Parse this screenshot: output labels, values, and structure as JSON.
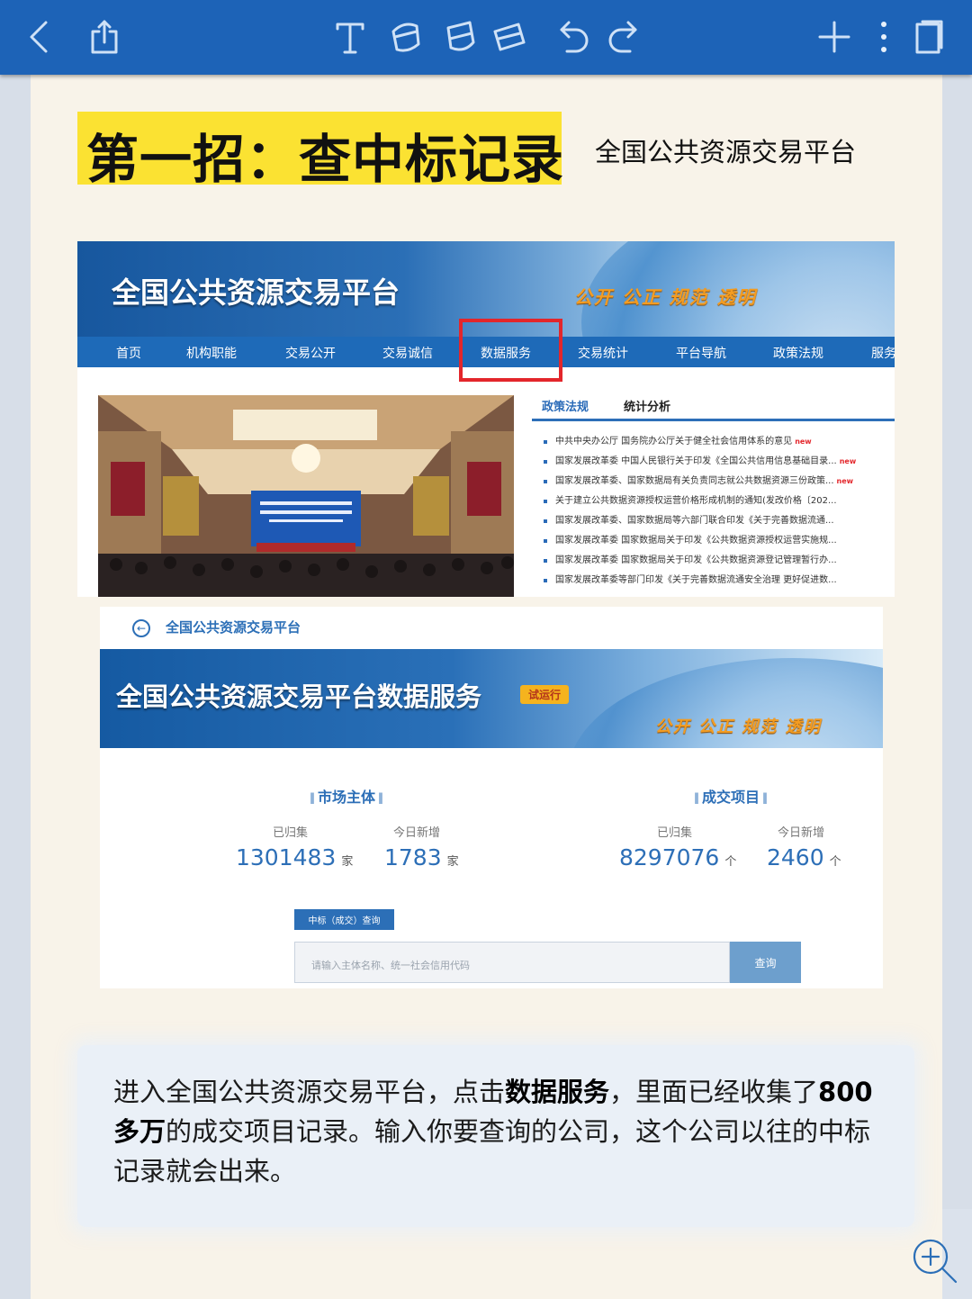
{
  "toolbar": {
    "icons": [
      "back-icon",
      "share-icon",
      "text-tool-icon",
      "pen-tool-icon",
      "highlighter-tool-icon",
      "eraser-tool-icon",
      "undo-icon",
      "redo-icon",
      "add-icon",
      "more-icon",
      "page-view-icon"
    ]
  },
  "page": {
    "title": "第一招：查中标记录",
    "subtitle": "全国公共资源交易平台"
  },
  "shot1": {
    "banner_title": "全国公共资源交易平台",
    "slogan": "公开 公正 规范 透明",
    "nav": [
      "首页",
      "机构职能",
      "交易公开",
      "交易诚信",
      "数据服务",
      "交易统计",
      "平台导航",
      "政策法规",
      "服务"
    ],
    "highlighted_nav": "数据服务",
    "tabs": [
      "政策法规",
      "统计分析"
    ],
    "news": [
      {
        "text": "中共中央办公厅 国务院办公厅关于健全社会信用体系的意见",
        "new": "new"
      },
      {
        "text": "国家发展改革委 中国人民银行关于印发《全国公共信用信息基础目录...",
        "new": "new"
      },
      {
        "text": "国家发展改革委、国家数据局有关负责同志就公共数据资源三份政策...",
        "new": "new"
      },
      {
        "text": "关于建立公共数据资源授权运营价格形成机制的通知(发改价格〔202...",
        "new": ""
      },
      {
        "text": "国家发展改革委、国家数据局等六部门联合印发《关于完善数据流通...",
        "new": ""
      },
      {
        "text": "国家发展改革委 国家数据局关于印发《公共数据资源授权运营实施规...",
        "new": ""
      },
      {
        "text": "国家发展改革委 国家数据局关于印发《公共数据资源登记管理暂行办...",
        "new": ""
      },
      {
        "text": "国家发展改革委等部门印发《关于完善数据流通安全治理 更好促进数...",
        "new": ""
      }
    ]
  },
  "shot2": {
    "back_label": "全国公共资源交易平台",
    "banner_title": "全国公共资源交易平台数据服务",
    "badge": "试运行",
    "slogan": "公开 公正 规范 透明",
    "market": {
      "heading": "市场主体",
      "collected_label": "已归集",
      "collected_value": "1301483",
      "collected_unit": "家",
      "today_label": "今日新增",
      "today_value": "1783",
      "today_unit": "家"
    },
    "deals": {
      "heading": "成交项目",
      "collected_label": "已归集",
      "collected_value": "8297076",
      "collected_unit": "个",
      "today_label": "今日新增",
      "today_value": "2460",
      "today_unit": "个"
    },
    "query_tab": "中标（成交）查询",
    "search_placeholder": "请输入主体名称、统一社会信用代码",
    "search_button": "查询"
  },
  "caption": {
    "part1": "进入全国公共资源交易平台，点击",
    "bold1": "数据服务",
    "part2": "，里面已经收集了",
    "bold2": "800多万",
    "part3": "的成交项目记录。输入你要查询的公司，这个公司以往的中标记录就会出来。"
  },
  "colors": {
    "toolbar": "#1d63b7",
    "highlight": "#fbe232",
    "accent": "#2d6fb7",
    "red_box": "#e3262b"
  }
}
